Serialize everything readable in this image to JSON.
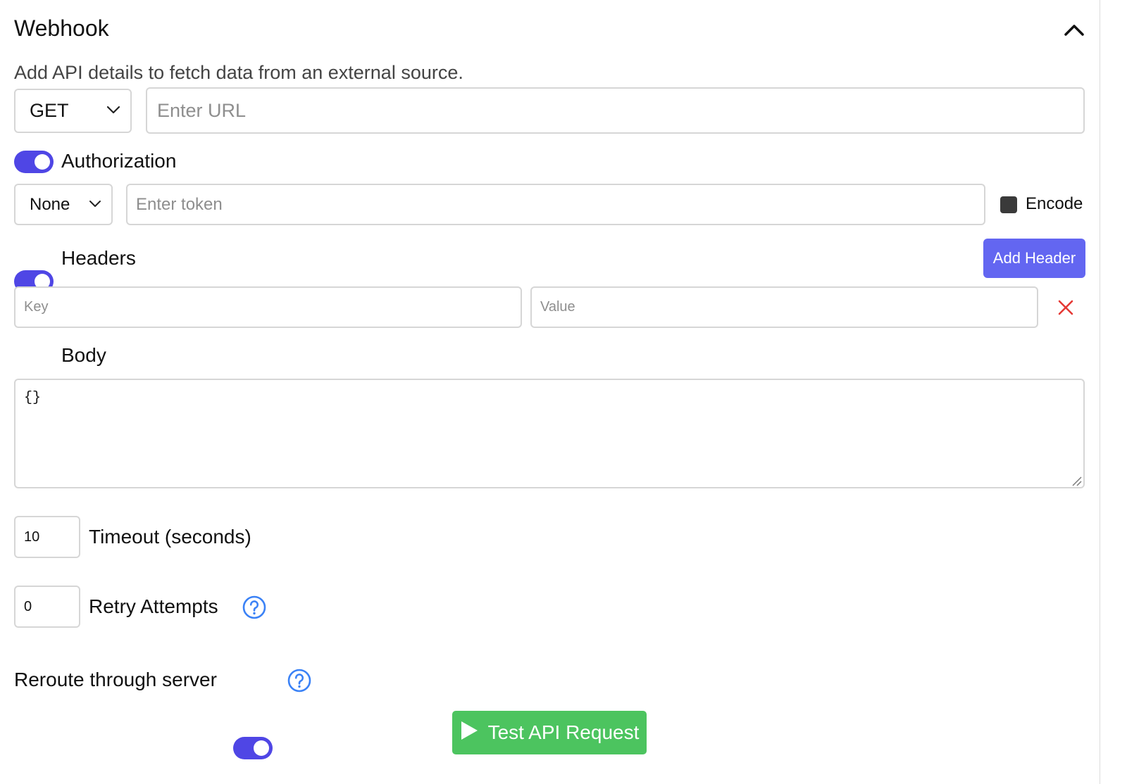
{
  "panel": {
    "title": "Webhook",
    "description": "Add API details to fetch data from an external source."
  },
  "request": {
    "method": "GET",
    "url_value": "",
    "url_placeholder": "Enter URL"
  },
  "authorization": {
    "label": "Authorization",
    "enabled": true,
    "type": "None",
    "token_value": "",
    "token_placeholder": "Enter token",
    "encode_label": "Encode"
  },
  "headers": {
    "label": "Headers",
    "enabled": true,
    "add_button_label": "Add Header",
    "rows": [
      {
        "key_placeholder": "Key",
        "value_placeholder": "Value",
        "key": "",
        "value": ""
      }
    ]
  },
  "body": {
    "label": "Body",
    "enabled": true,
    "content": "{}"
  },
  "timeout": {
    "value": "10",
    "label": "Timeout (seconds)"
  },
  "retry": {
    "value": "0",
    "label": "Retry Attempts"
  },
  "reroute": {
    "label": "Reroute through server",
    "enabled": true
  },
  "test_button": {
    "label": "Test API Request"
  },
  "colors": {
    "toggle_on": "#4f46e5",
    "primary_button": "#6366f1",
    "test_button": "#4cc45f",
    "remove_icon": "#e53935",
    "help_icon": "#3b82f6"
  },
  "icons": {
    "collapse": "chevron-up-icon",
    "method_dropdown": "chevron-down-icon",
    "auth_dropdown": "chevron-down-icon",
    "remove_header": "close-icon",
    "help": "question-circle-icon",
    "play": "play-icon"
  }
}
